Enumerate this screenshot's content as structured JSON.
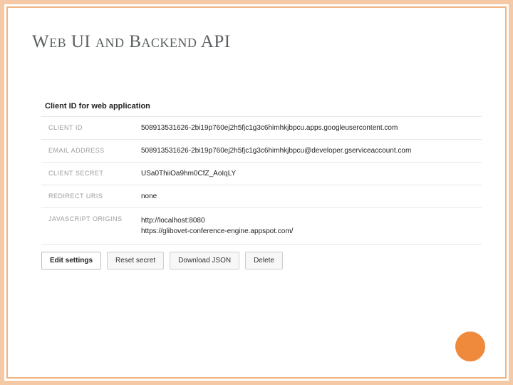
{
  "slide": {
    "title": "Web UI and Backend API"
  },
  "panel": {
    "heading": "Client ID for web application",
    "rows": [
      {
        "label": "CLIENT ID",
        "value": "508913531626-2bi19p760ej2h5fjc1g3c6himhkjbpcu.apps.googleusercontent.com"
      },
      {
        "label": "EMAIL ADDRESS",
        "value": "508913531626-2bi19p760ej2h5fjc1g3c6himhkjbpcu@developer.gserviceaccount.com"
      },
      {
        "label": "CLIENT SECRET",
        "value": "USa0ThiiOa9hm0CfZ_AoIqLY"
      },
      {
        "label": "REDIRECT URIS",
        "value": "none"
      },
      {
        "label": "JAVASCRIPT ORIGINS",
        "value": "http://localhost:8080\nhttps://glibovet-conference-engine.appspot.com/"
      }
    ],
    "buttons": {
      "edit": "Edit settings",
      "reset": "Reset secret",
      "download": "Download JSON",
      "delete": "Delete"
    }
  }
}
